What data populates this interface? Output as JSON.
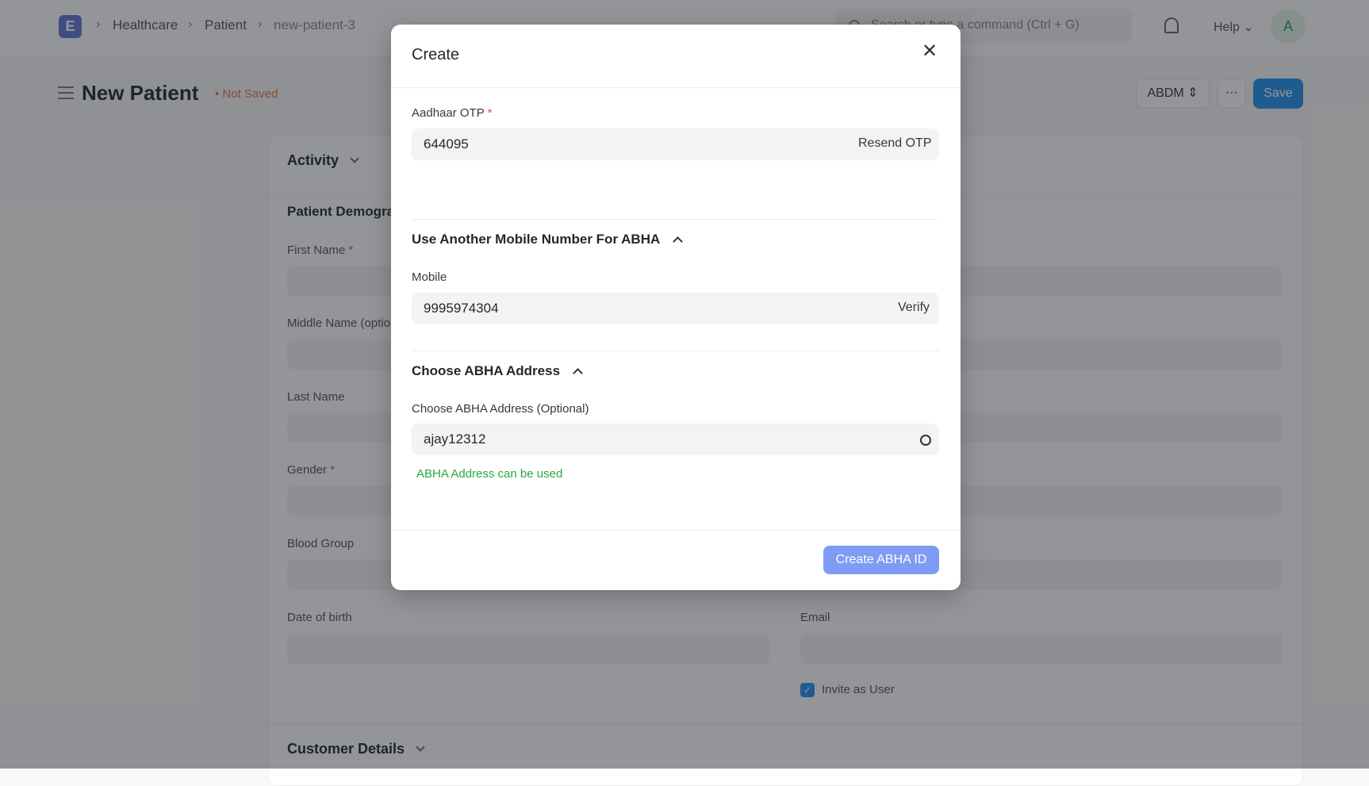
{
  "topbar": {
    "logo": "E",
    "breadcrumbs": [
      "Healthcare",
      "Patient",
      "new-patient-3"
    ],
    "search_placeholder": "Search or type a command (Ctrl + G)",
    "help": "Help",
    "avatar": "A"
  },
  "page": {
    "title": "New Patient",
    "status": "Not Saved",
    "abdm_button": "ABDM",
    "more_button": "···",
    "save_button": "Save"
  },
  "form": {
    "activity": "Activity",
    "section": "Patient Demographics",
    "fields": {
      "first_name": "First Name",
      "middle_name": "Middle Name (optional)",
      "last_name": "Last Name",
      "gender": "Gender",
      "blood_group": "Blood Group",
      "dob": "Date of birth",
      "email": "Email",
      "invite": "Invite as User"
    },
    "customer_details": "Customer Details"
  },
  "modal": {
    "title": "Create",
    "otp_label": "Aadhaar OTP",
    "otp_value": "644095",
    "resend": "Resend OTP",
    "mobile_section": "Use Another Mobile Number For ABHA",
    "mobile_label": "Mobile",
    "mobile_value": "9995974304",
    "verify": "Verify",
    "abha_section": "Choose ABHA Address",
    "abha_label": "Choose ABHA Address (Optional)",
    "abha_value": "ajay12312",
    "abha_status": "ABHA Address can be used",
    "create_button": "Create ABHA ID"
  },
  "colors": {
    "accent": "#2490ef",
    "success": "#28a745",
    "create_button": "#7f9bf5"
  }
}
